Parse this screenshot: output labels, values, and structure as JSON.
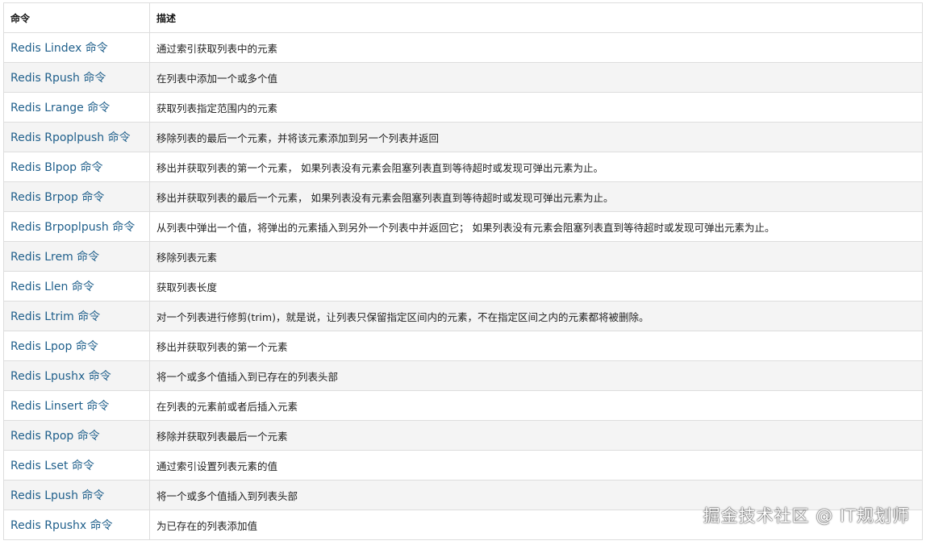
{
  "table": {
    "headers": [
      "命令",
      "描述"
    ],
    "rows": [
      {
        "command": "Redis Lindex 命令",
        "description": "通过索引获取列表中的元素"
      },
      {
        "command": "Redis Rpush 命令",
        "description": "在列表中添加一个或多个值"
      },
      {
        "command": "Redis Lrange 命令",
        "description": "获取列表指定范围内的元素"
      },
      {
        "command": "Redis Rpoplpush 命令",
        "description": "移除列表的最后一个元素，并将该元素添加到另一个列表并返回"
      },
      {
        "command": "Redis Blpop 命令",
        "description": "移出并获取列表的第一个元素， 如果列表没有元素会阻塞列表直到等待超时或发现可弹出元素为止。"
      },
      {
        "command": "Redis Brpop 命令",
        "description": "移出并获取列表的最后一个元素， 如果列表没有元素会阻塞列表直到等待超时或发现可弹出元素为止。"
      },
      {
        "command": "Redis Brpoplpush 命令",
        "description": "从列表中弹出一个值，将弹出的元素插入到另外一个列表中并返回它； 如果列表没有元素会阻塞列表直到等待超时或发现可弹出元素为止。"
      },
      {
        "command": "Redis Lrem 命令",
        "description": "移除列表元素"
      },
      {
        "command": "Redis Llen 命令",
        "description": "获取列表长度"
      },
      {
        "command": "Redis Ltrim 命令",
        "description": "对一个列表进行修剪(trim)，就是说，让列表只保留指定区间内的元素，不在指定区间之内的元素都将被删除。"
      },
      {
        "command": "Redis Lpop 命令",
        "description": "移出并获取列表的第一个元素"
      },
      {
        "command": "Redis Lpushx 命令",
        "description": "将一个或多个值插入到已存在的列表头部"
      },
      {
        "command": "Redis Linsert 命令",
        "description": "在列表的元素前或者后插入元素"
      },
      {
        "command": "Redis Rpop 命令",
        "description": "移除并获取列表最后一个元素"
      },
      {
        "command": "Redis Lset 命令",
        "description": "通过索引设置列表元素的值"
      },
      {
        "command": "Redis Lpush 命令",
        "description": "将一个或多个值插入到列表头部"
      },
      {
        "command": "Redis Rpushx 命令",
        "description": "为已存在的列表添加值"
      }
    ]
  },
  "watermark": "掘金技术社区 @ IT规划师",
  "colors": {
    "link": "#1f5f8b",
    "row_alt": "#f4f4f4",
    "border": "#dddddd"
  }
}
